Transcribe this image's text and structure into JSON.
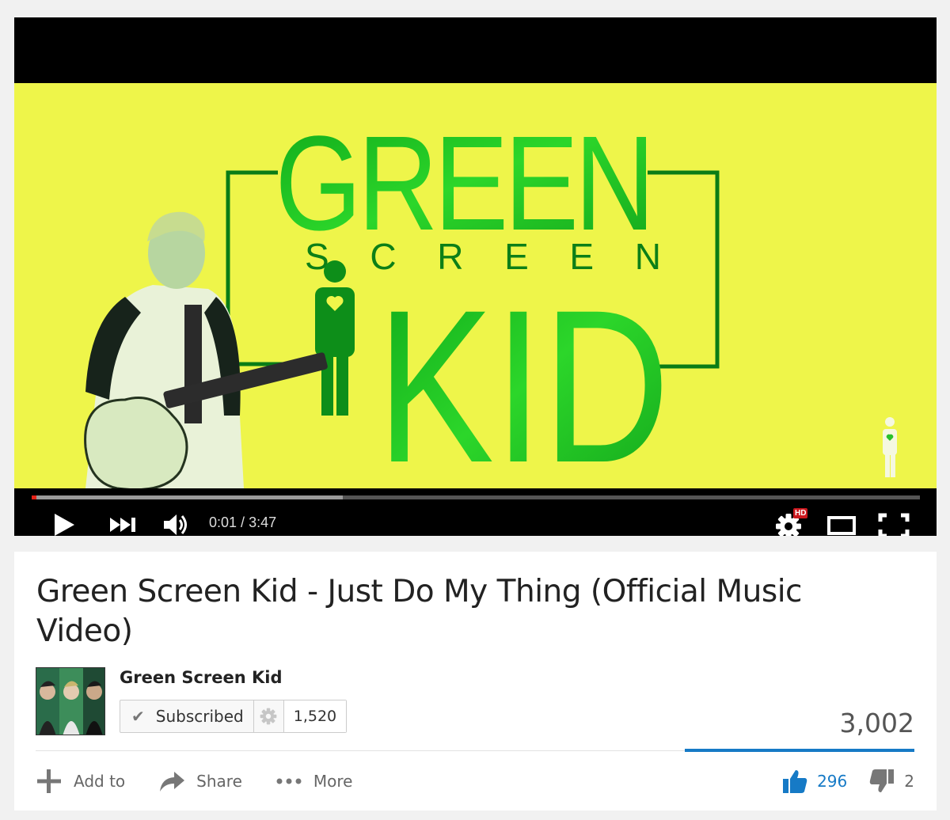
{
  "player": {
    "current_time": "0:01",
    "duration": "3:47",
    "time_separator": " / ",
    "played_fraction": 0.005,
    "buffered_fraction": 0.35,
    "hd_badge": "HD",
    "artwork": {
      "title_line1": "GREEN",
      "title_line2": "SCREEN",
      "title_line3": "KID",
      "accent_color": "#17c21b",
      "background_color": "#eef54a"
    }
  },
  "video": {
    "title": "Green Screen Kid - Just Do My Thing (Official Music Video)",
    "view_count": "3,002"
  },
  "channel": {
    "name": "Green Screen Kid",
    "subscribe_label": "Subscribed",
    "subscriber_count": "1,520"
  },
  "actions": {
    "add_to": "Add to",
    "share": "Share",
    "more": "More"
  },
  "ratings": {
    "likes": "296",
    "dislikes": "2",
    "like_fraction": 0.993
  },
  "colors": {
    "progress_played": "#e62117",
    "accent_blue": "#167ac6",
    "hd_red": "#cc181e"
  }
}
